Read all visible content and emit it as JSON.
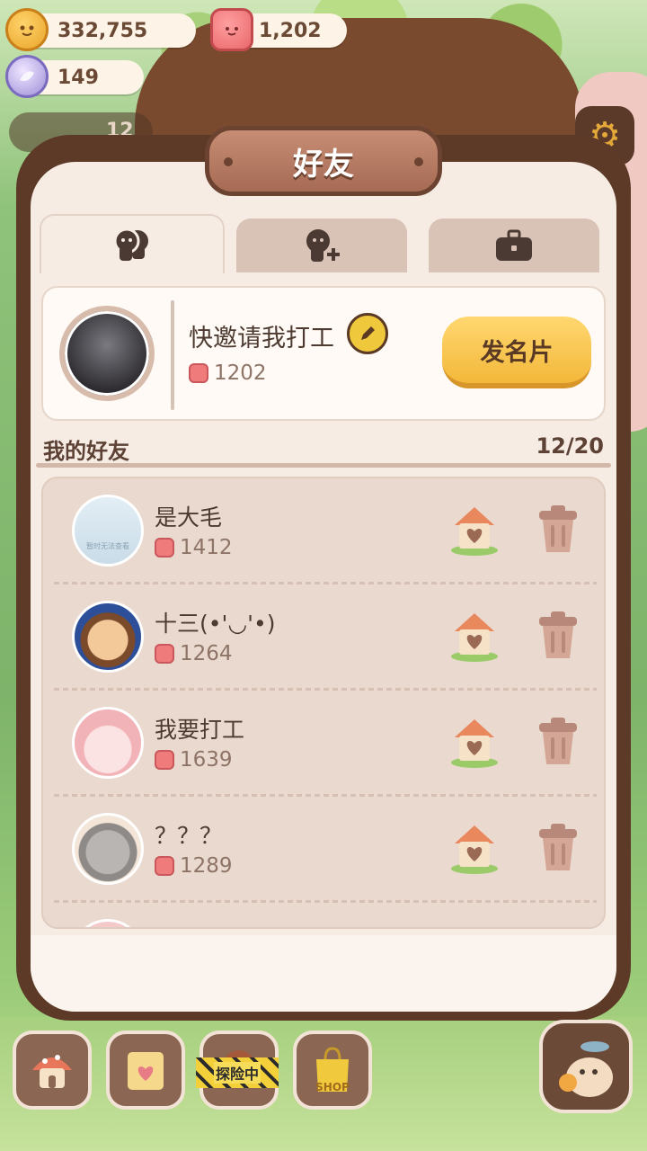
{
  "currencies": {
    "coins": "332,755",
    "gems": "1,202",
    "crystals": "149"
  },
  "background_counter": "12",
  "panel": {
    "title": "好友"
  },
  "tabs": [
    {
      "name": "friends",
      "icon": "friends-icon",
      "active": true
    },
    {
      "name": "add-friend",
      "icon": "add-friend-icon",
      "active": false
    },
    {
      "name": "work",
      "icon": "briefcase-icon",
      "active": false
    }
  ],
  "profile": {
    "name": "快邀请我打工",
    "score": "1202",
    "card_button": "发名片"
  },
  "friends_header": {
    "title": "我的好友",
    "count": "12/20"
  },
  "friends": [
    {
      "name": "是大毛",
      "score": "1412",
      "avatar_placeholder": "暂时无法查看"
    },
    {
      "name": "十三(•'◡'•)",
      "score": "1264"
    },
    {
      "name": "我要打工",
      "score": "1639"
    },
    {
      "name": "？？？",
      "score": "1289"
    }
  ],
  "bottom_nav": {
    "exploring_label": "探险中",
    "shop_label": "SHOP"
  },
  "colors": {
    "panel_border": "#5c3a27",
    "panel_bg": "#f6ece4",
    "button_yellow": "#f3b83a",
    "list_bg": "#ead9cf",
    "text_dark": "#4d3a30",
    "text_muted": "#8e7466"
  }
}
